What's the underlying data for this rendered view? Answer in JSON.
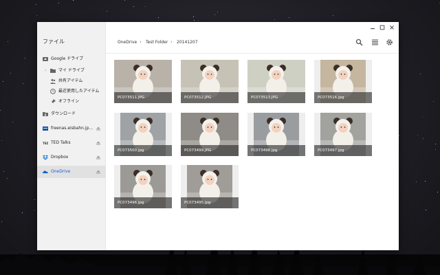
{
  "sidebar": {
    "title": "ファイル",
    "items": [
      {
        "label": "Google ドライブ",
        "icon": "drive-icon"
      },
      {
        "label": "マイ ドライブ",
        "icon": "folder-icon"
      },
      {
        "label": "共有アイテム",
        "icon": "people-icon"
      },
      {
        "label": "最近使用したアイテム",
        "icon": "clock-icon"
      },
      {
        "label": "オフライン",
        "icon": "pin-icon"
      },
      {
        "label": "ダウンロード",
        "icon": "download-icon"
      },
      {
        "label": "freenas.eisbahn.jp...",
        "icon": "nas-icon"
      },
      {
        "label": "TED Talks",
        "icon": "ted-icon"
      },
      {
        "label": "Dropbox",
        "icon": "dropbox-icon"
      },
      {
        "label": "OneDrive",
        "icon": "onedrive-icon"
      }
    ]
  },
  "breadcrumb": [
    "OneDrive",
    "Test Folder",
    "20141207"
  ],
  "files": [
    {
      "name": "PC073511.JPG"
    },
    {
      "name": "PC073512.JPG"
    },
    {
      "name": "PC073513.JPG"
    },
    {
      "name": "PC073516.jpg"
    },
    {
      "name": "PC073500.jpg"
    },
    {
      "name": "PC073499.JPG"
    },
    {
      "name": "PC073498.jpg"
    },
    {
      "name": "PC073497.jpg"
    },
    {
      "name": "PC073496.jpg"
    },
    {
      "name": "PC073495.jpg"
    }
  ],
  "colors": {
    "accent": "#1a5fd0",
    "sidebar_bg": "#f1f1f1"
  }
}
